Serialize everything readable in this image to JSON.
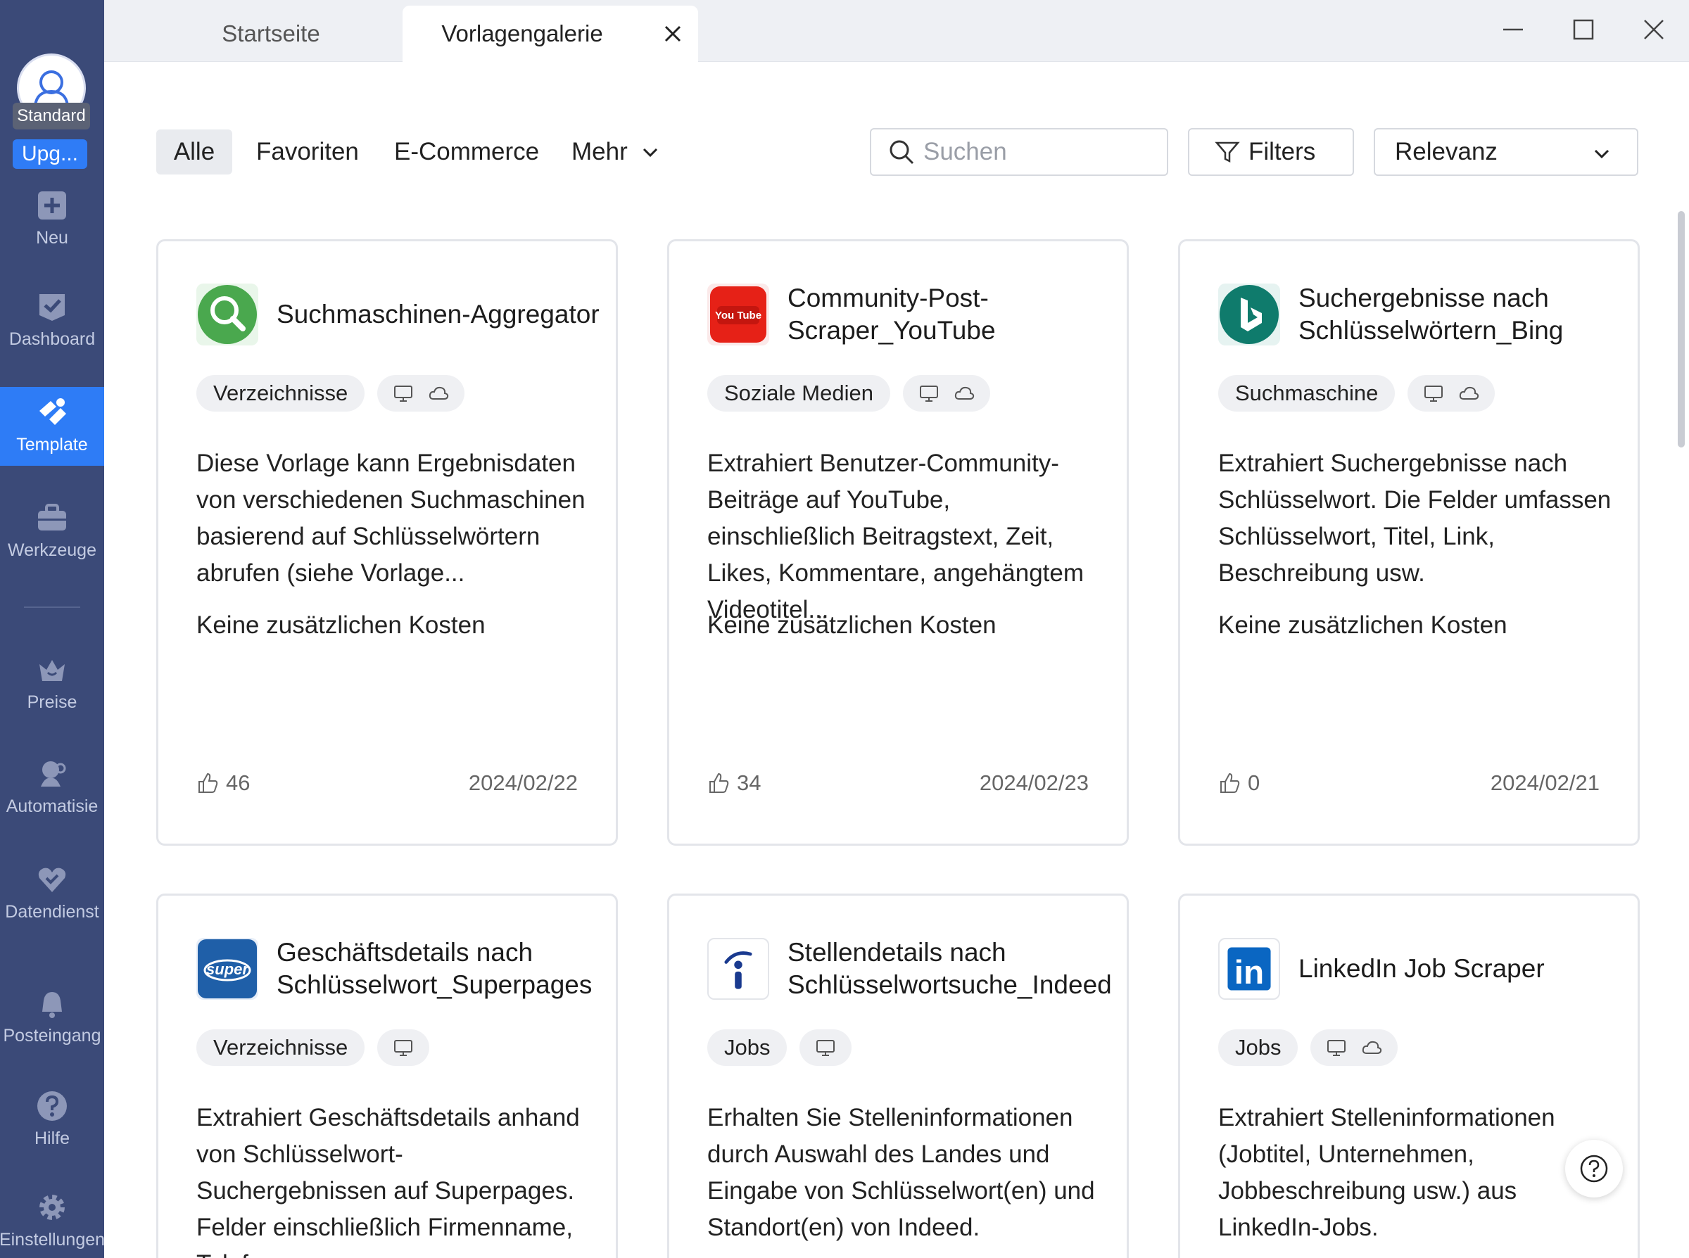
{
  "sidebar": {
    "plan_badge": "Standard",
    "upgrade_label": "Upg...",
    "items": [
      {
        "label": "Neu"
      },
      {
        "label": "Dashboard"
      },
      {
        "label": "Template"
      },
      {
        "label": "Werkzeuge"
      },
      {
        "label": "Preise"
      },
      {
        "label": "Automatisie"
      },
      {
        "label": "Datendienst"
      },
      {
        "label": "Posteingang"
      },
      {
        "label": "Hilfe"
      },
      {
        "label": "Einstellungen"
      }
    ],
    "active_item": "Template"
  },
  "tabs": [
    {
      "label": "Startseite"
    },
    {
      "label": "Vorlagengalerie"
    }
  ],
  "active_tab": "Vorlagengalerie",
  "filters": {
    "categories": [
      "Alle",
      "Favoriten",
      "E-Commerce",
      "Mehr"
    ],
    "active_category": "Alle",
    "search_placeholder": "Suchen",
    "filters_label": "Filters",
    "sort_value": "Relevanz"
  },
  "cards": [
    {
      "title": "Suchmaschinen-Aggregator",
      "logo": "magnifier-logo-icon",
      "tag": "Verzeichnisse",
      "modes": [
        "desktop-icon",
        "cloud-icon"
      ],
      "description": "Diese Vorlage kann Ergebnisdaten von verschiedenen Suchmaschinen basierend auf Schlüsselwörtern abrufen (siehe Vorlage...",
      "cost": "Keine zusätzlichen Kosten",
      "likes": "46",
      "date": "2024/02/22"
    },
    {
      "title": "Community-Post-Scraper_YouTube",
      "logo": "youtube-logo-icon",
      "logo_text": "You Tube",
      "tag": "Soziale Medien",
      "modes": [
        "desktop-icon",
        "cloud-icon"
      ],
      "description": "Extrahiert Benutzer-Community-Beiträge auf YouTube, einschließlich Beitragstext, Zeit, Likes, Kommentare, angehängtem Videotitel...",
      "cost": "Keine zusätzlichen Kosten",
      "likes": "34",
      "date": "2024/02/23"
    },
    {
      "title": "Suchergebnisse nach Schlüsselwörtern_Bing",
      "logo": "bing-logo-icon",
      "tag": "Suchmaschine",
      "modes": [
        "desktop-icon",
        "cloud-icon"
      ],
      "description": "Extrahiert Suchergebnisse nach Schlüsselwort. Die Felder umfassen Schlüsselwort, Titel, Link, Beschreibung usw.",
      "cost": "Keine zusätzlichen Kosten",
      "likes": "0",
      "date": "2024/02/21"
    },
    {
      "title": "Geschäftsdetails nach Schlüsselwort_Superpages",
      "logo": "superpages-logo-icon",
      "logo_text": "super",
      "tag": "Verzeichnisse",
      "modes": [
        "desktop-icon"
      ],
      "description": "Extrahiert Geschäftsdetails anhand von Schlüsselwort-Suchergebnissen auf Superpages. Felder einschließlich Firmenname, Telefon..."
    },
    {
      "title": "Stellendetails nach Schlüsselwortsuche_Indeed",
      "logo": "indeed-logo-icon",
      "tag": "Jobs",
      "modes": [
        "desktop-icon"
      ],
      "description": "Erhalten Sie Stelleninformationen durch Auswahl des Landes und Eingabe von Schlüsselwort(en) und Standort(en) von Indeed."
    },
    {
      "title": "LinkedIn Job Scraper",
      "logo": "linkedin-logo-icon",
      "logo_text": "in",
      "tag": "Jobs",
      "modes": [
        "desktop-icon",
        "cloud-icon"
      ],
      "description": "Extrahiert Stelleninformationen (Jobtitel, Unternehmen, Jobbeschreibung usw.) aus LinkedIn-Jobs."
    }
  ],
  "colors": {
    "sidebar_bg": "#3b4a78",
    "accent": "#2e7cf6",
    "youtube": "#e62117",
    "bing": "#0f7b6c",
    "linkedin": "#0a66c2",
    "superpages": "#1f5fa8",
    "indeed": "#1a3a8f"
  }
}
